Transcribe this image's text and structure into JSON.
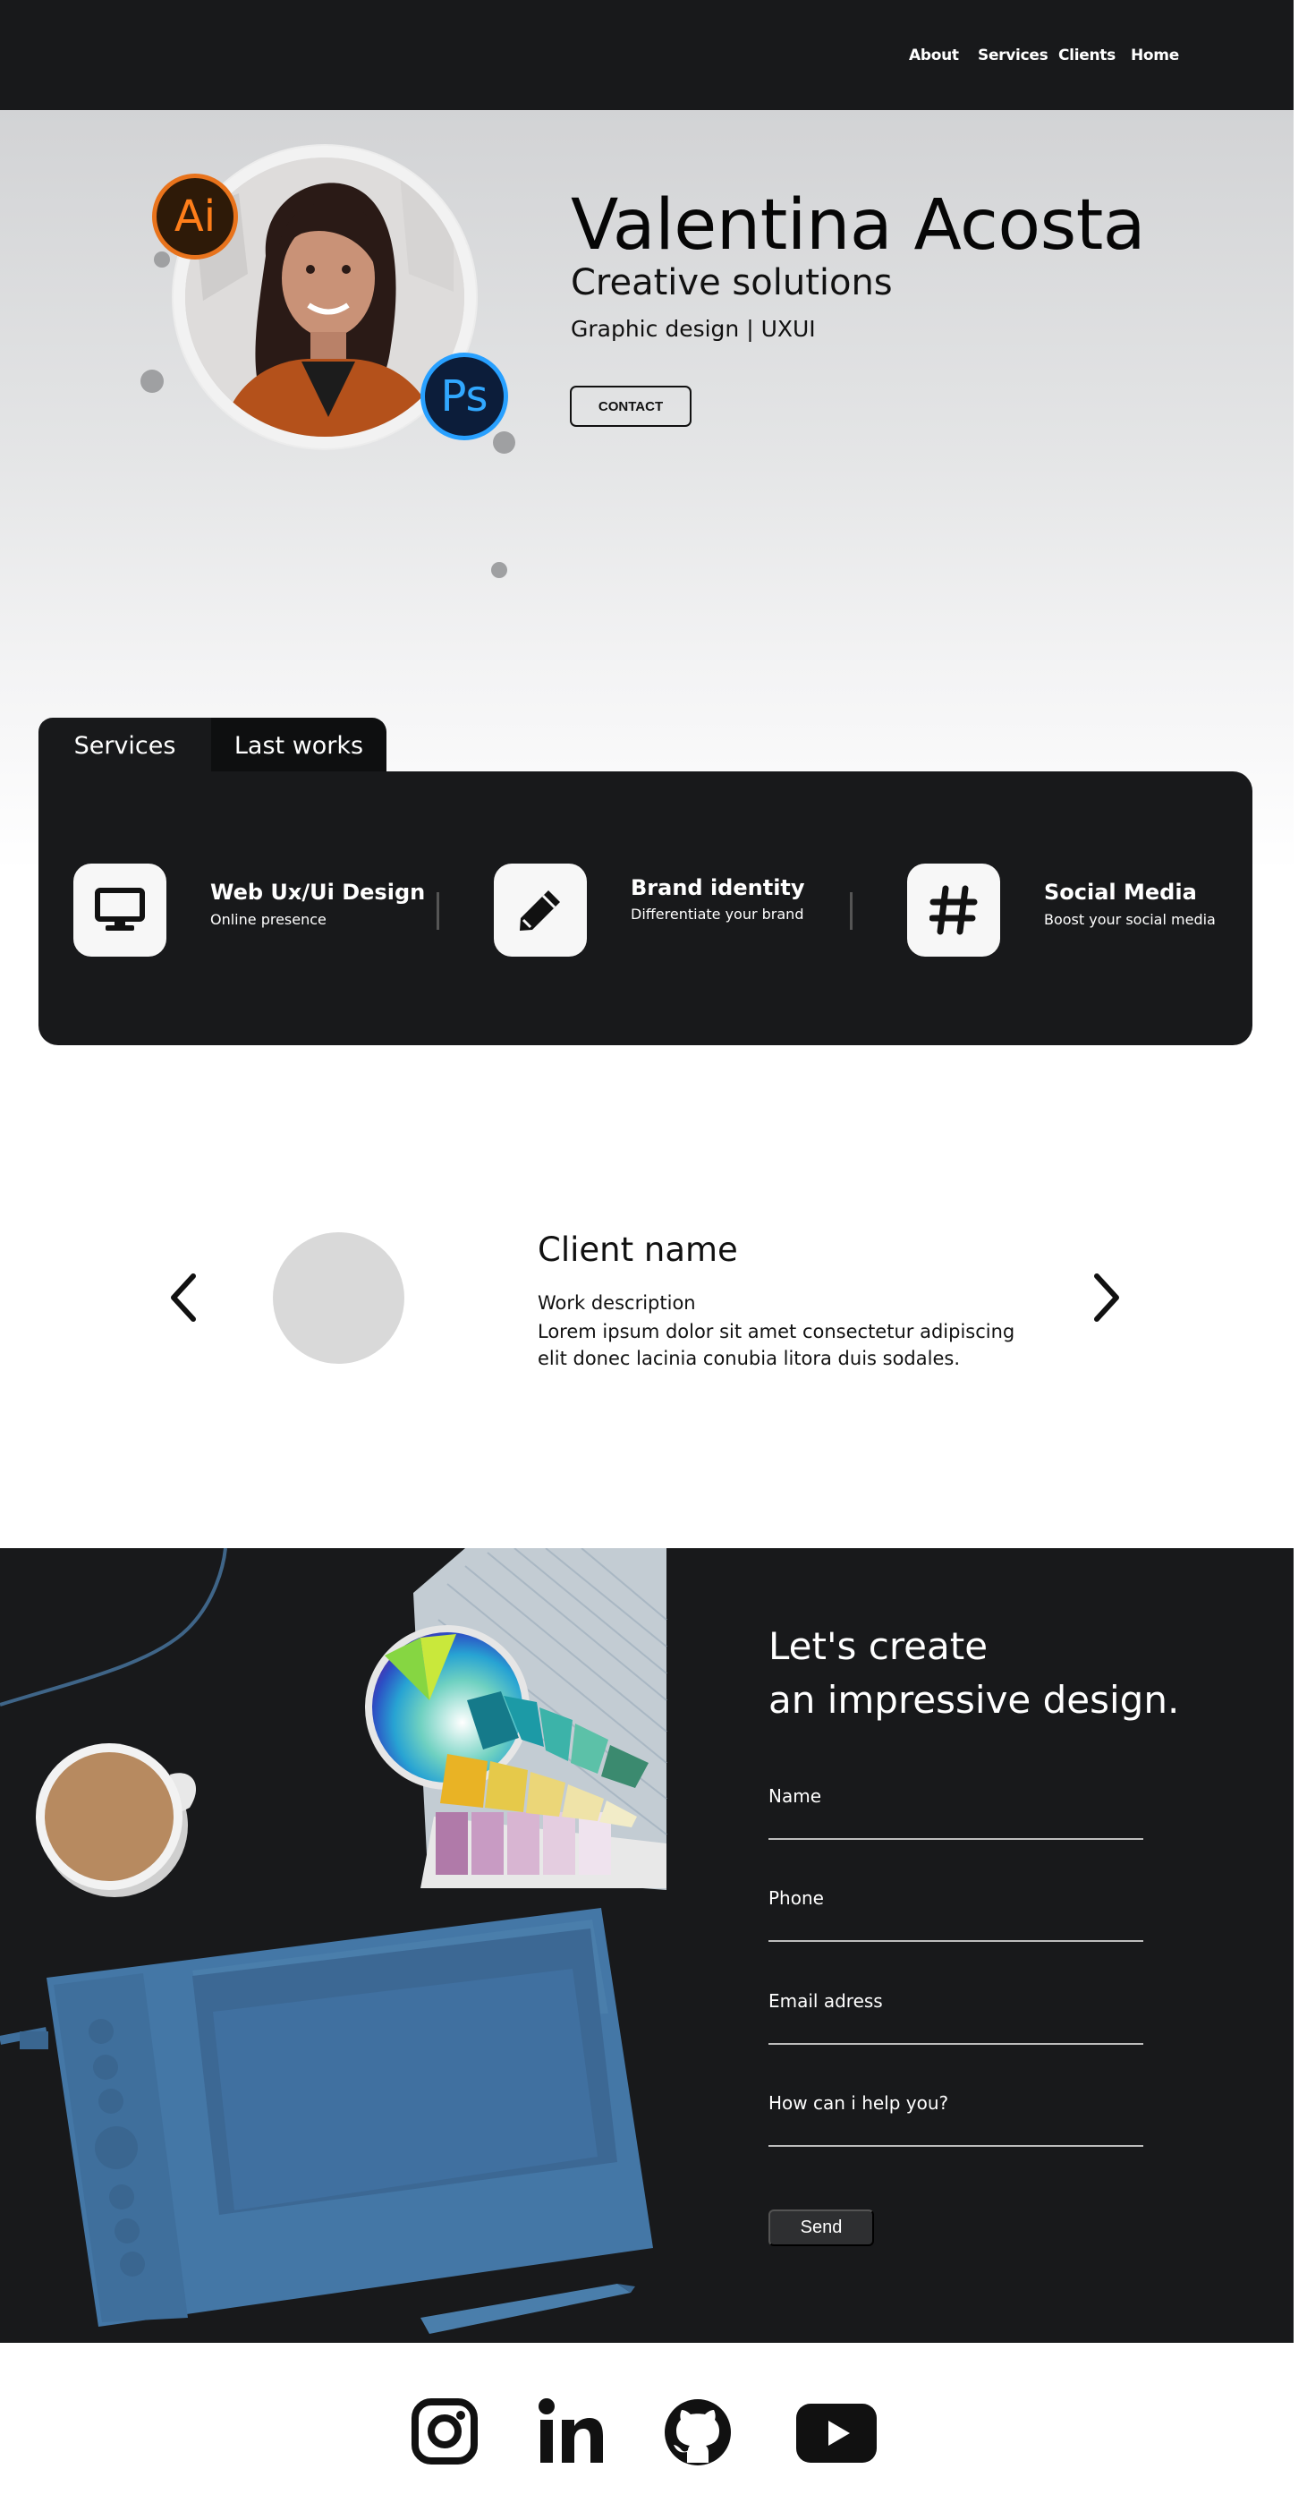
{
  "nav": {
    "items": [
      "About",
      "Services",
      "Clients",
      "Home"
    ]
  },
  "hero": {
    "name": "Valentina Acosta",
    "subtitle": "Creative solutions",
    "tagline": "Graphic design | UXUI",
    "contact_label": "CONTACT",
    "badge_ai": "Ai",
    "badge_ps": "Ps"
  },
  "tabs": {
    "services": "Services",
    "works": "Last works"
  },
  "services": [
    {
      "title": "Web Ux/Ui Design",
      "desc": "Online presence",
      "icon": "monitor-icon"
    },
    {
      "title": "Brand identity",
      "desc": "Differentiate your brand",
      "icon": "pencil-icon"
    },
    {
      "title": "Social Media",
      "desc": "Boost your social media",
      "icon": "hashtag-icon"
    }
  ],
  "client": {
    "name": "Client name",
    "work": "Work description",
    "text": "Lorem ipsum dolor sit amet consectetur adipiscing elit donec lacinia conubia litora duis sodales."
  },
  "contact": {
    "title_line1": "Let's create",
    "title_line2": "an impressive design.",
    "fields": [
      "Name",
      "Phone",
      "Email adress",
      "How can i help you?"
    ],
    "send_label": "Send"
  },
  "social": [
    "instagram-icon",
    "linkedin-icon",
    "github-icon",
    "youtube-icon"
  ],
  "colors": {
    "dark": "#18191b",
    "white": "#ffffff",
    "ai_orange": "#ff7e1a",
    "ps_blue": "#31a8ff",
    "tablet_blue": "#4477a6"
  }
}
